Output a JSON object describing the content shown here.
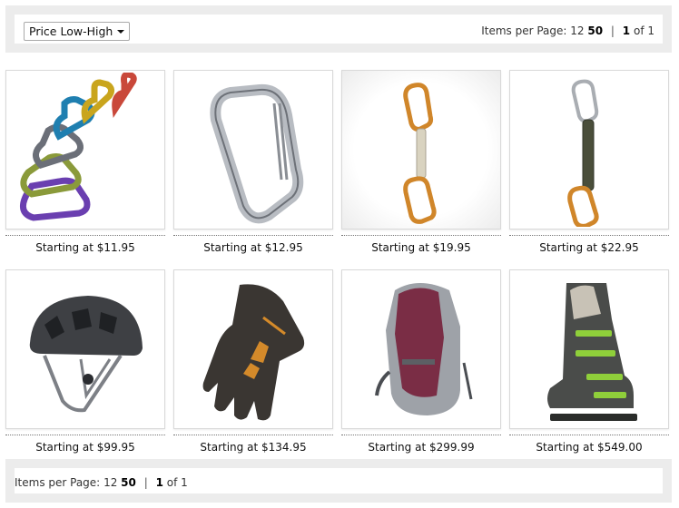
{
  "sort": {
    "selected": "Price Low-High"
  },
  "pagination": {
    "items_per_page_label": "Items per Page:",
    "per_page_options": [
      "12",
      "50"
    ],
    "current_page": "1",
    "of_label": "of 1"
  },
  "products": [
    {
      "name": "carabiner-set",
      "price": "Starting at $11.95"
    },
    {
      "name": "wiregate-carabiner",
      "price": "Starting at $12.95"
    },
    {
      "name": "quickdraw",
      "price": "Starting at $19.95"
    },
    {
      "name": "dogbone-quickdraw",
      "price": "Starting at $22.95"
    },
    {
      "name": "climbing-helmet",
      "price": "Starting at $99.95"
    },
    {
      "name": "climbing-glove",
      "price": "Starting at $134.95"
    },
    {
      "name": "backpack",
      "price": "Starting at $299.99"
    },
    {
      "name": "ski-boot",
      "price": "Starting at $549.00"
    }
  ],
  "colors": {
    "bar_bg": "#ececec",
    "carabiner_colors": [
      "#6a3fb0",
      "#8a9a3a",
      "#6b6f78",
      "#1f7fb0",
      "#c9a51d",
      "#c9483a"
    ],
    "boot_accent": "#8fcf3a"
  }
}
